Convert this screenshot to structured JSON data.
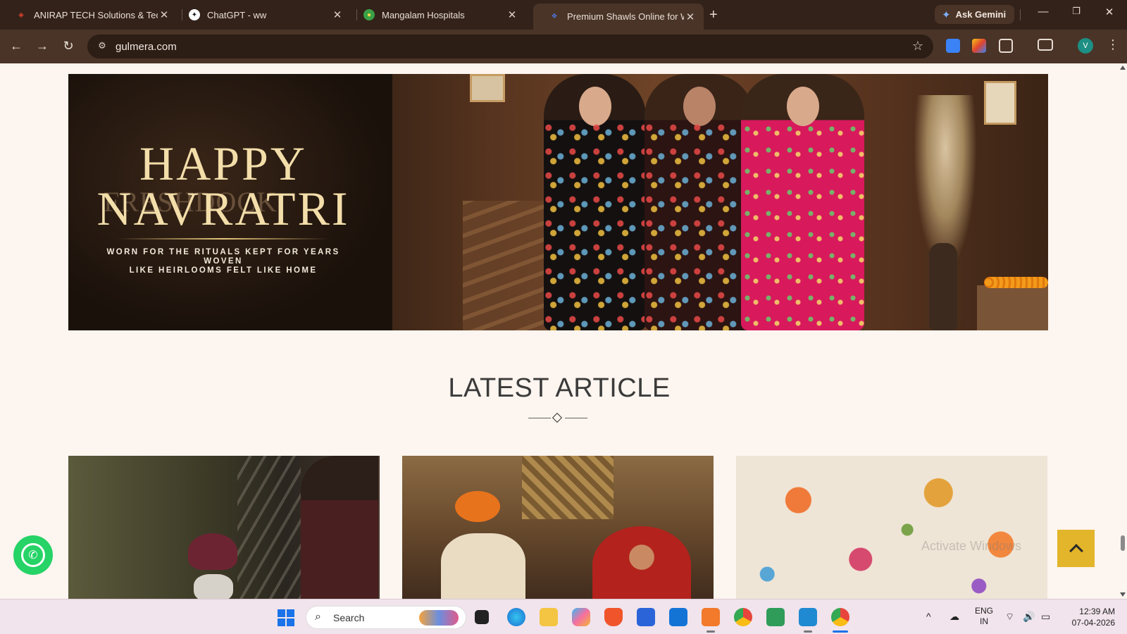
{
  "browser": {
    "tabs": [
      {
        "title": "ANIRAP TECH Solutions & Tech",
        "favicon": "laravel-icon",
        "color": "#e0442f"
      },
      {
        "title": "ChatGPT - ww",
        "favicon": "chatgpt-icon",
        "color": "#ffffff"
      },
      {
        "title": "Mangalam Hospitals",
        "favicon": "hospital-logo-icon",
        "color": "#3aa046"
      },
      {
        "title": "Premium Shawls Online for Wor",
        "favicon": "gulmera-logo-icon",
        "color": "#2a4ea0"
      }
    ],
    "active_tab_index": 3,
    "gemini_label": "Ask Gemini",
    "url": "gulmera.com",
    "profile_initial": "V"
  },
  "page": {
    "banner": {
      "headline_line1": "HAPPY",
      "headline_line2": "NAVRATRI",
      "ghost_text": "FRESHDOCK",
      "subtitle_line1": "WORN FOR THE RITUALS KEPT FOR YEARS WOVEN",
      "subtitle_line2": "LIKE HEIRLOOMS FELT LIKE HOME"
    },
    "section_title": "LATEST ARTICLE",
    "articles": [
      {
        "image": "elderly-sikh-man-photo"
      },
      {
        "image": "artisans-weaving-painting"
      },
      {
        "image": "embroidered-floral-shawl-photo"
      }
    ],
    "watermark": "Activate Windows"
  },
  "taskbar": {
    "search_label": "Search",
    "lang_line1": "ENG",
    "lang_line2": "IN",
    "time": "12:39 AM",
    "date": "07-04-2026"
  },
  "colors": {
    "page_bg": "#fdf5ef",
    "scroll_top_button": "#e2b52a",
    "whatsapp": "#25d366",
    "banner_gold": "#f3deaa"
  }
}
